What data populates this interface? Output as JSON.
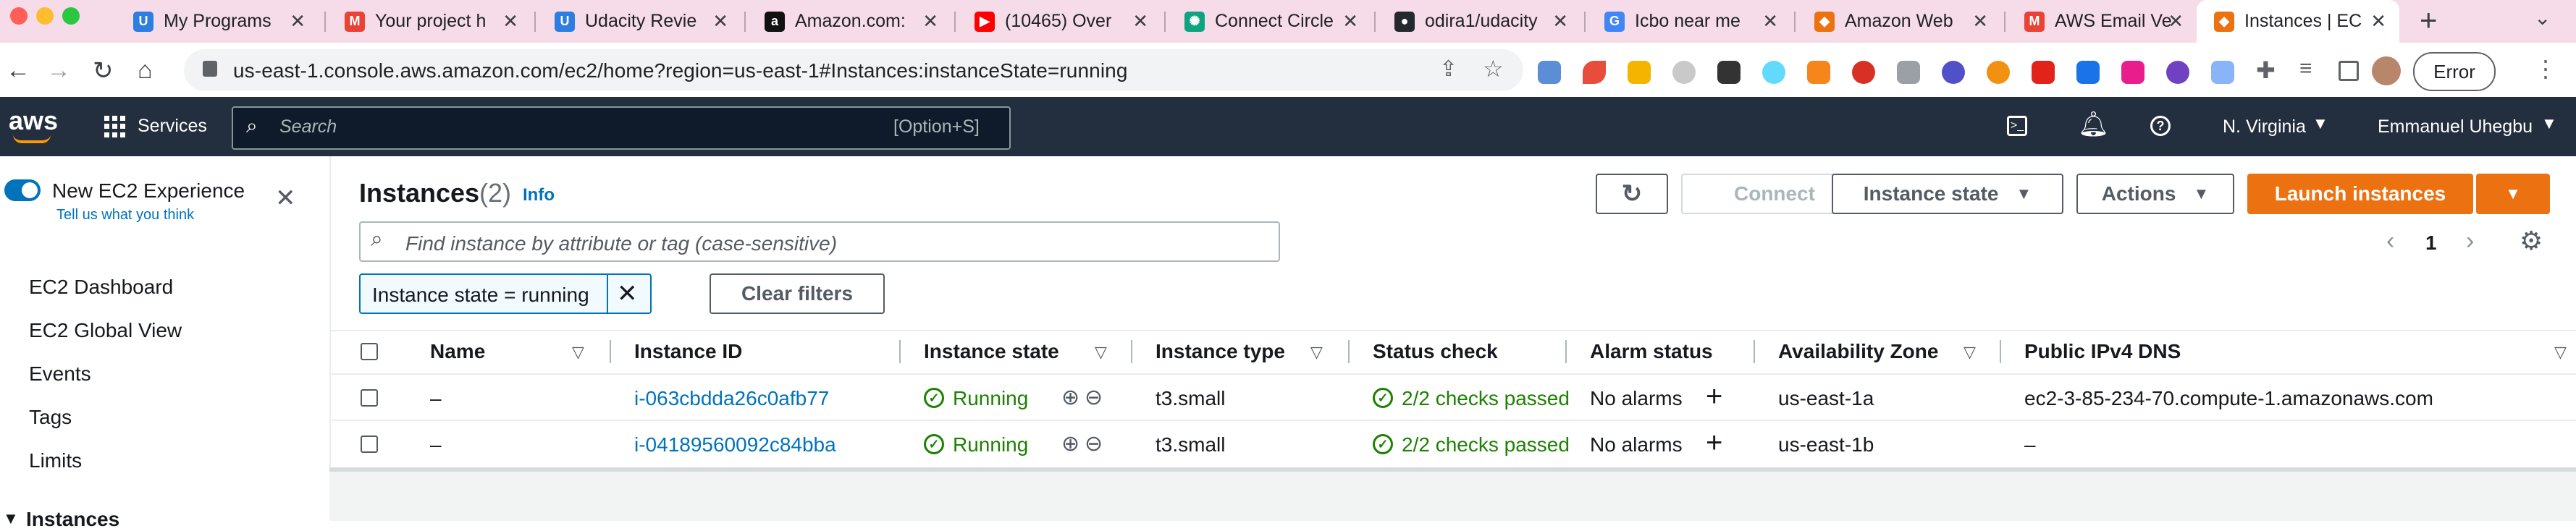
{
  "browser": {
    "tabs": [
      {
        "title": "My Programs",
        "icon": "udacity-icon",
        "color": "#2e7de1",
        "glyph": "U"
      },
      {
        "title": "Your project h",
        "icon": "gmail-icon",
        "color": "#ea4335",
        "glyph": "M"
      },
      {
        "title": "Udacity Revie",
        "icon": "udacity-icon",
        "color": "#2e7de1",
        "glyph": "U"
      },
      {
        "title": "Amazon.com:",
        "icon": "amazon-icon",
        "color": "#111111",
        "glyph": "a"
      },
      {
        "title": "(10465) Over",
        "icon": "youtube-icon",
        "color": "#ff0000",
        "glyph": "▶"
      },
      {
        "title": "Connect Circle",
        "icon": "chatgpt-icon",
        "color": "#10a37f",
        "glyph": "✺"
      },
      {
        "title": "odira1/udacity",
        "icon": "github-icon",
        "color": "#24292f",
        "glyph": "●"
      },
      {
        "title": "Icbo near me",
        "icon": "google-icon",
        "color": "#4285f4",
        "glyph": "G"
      },
      {
        "title": "Amazon Web",
        "icon": "aws-cube-icon",
        "color": "#ec7211",
        "glyph": "◆"
      },
      {
        "title": "AWS Email Ve",
        "icon": "gmail-icon",
        "color": "#ea4335",
        "glyph": "M"
      },
      {
        "title": "Instances | EC",
        "icon": "aws-cube-icon",
        "color": "#ec7211",
        "glyph": "◆"
      }
    ],
    "new_tab": "+",
    "url": "us-east-1.console.aws.amazon.com/ec2/home?region=us-east-1#Instances:instanceState=running",
    "error_label": "Error"
  },
  "aws_nav": {
    "logo": "aws",
    "services_label": "Services",
    "search_placeholder": "Search",
    "search_shortcut": "[Option+S]",
    "region": "N. Virginia",
    "user": "Emmanuel Uhegbu"
  },
  "side": {
    "toggle_label": "New EC2 Experience",
    "tell_us": "Tell us what you think",
    "links": [
      "EC2 Dashboard",
      "EC2 Global View",
      "Events",
      "Tags",
      "Limits"
    ],
    "section": "Instances"
  },
  "main": {
    "title": "Instances",
    "count": "(2)",
    "info": "Info",
    "connect": "Connect",
    "instance_state": "Instance state",
    "actions": "Actions",
    "launch": "Launch instances",
    "search_placeholder": "Find instance by attribute or tag (case-sensitive)",
    "filter_token": "Instance state = running",
    "clear_filters": "Clear filters",
    "page": "1"
  },
  "table": {
    "columns": [
      "Name",
      "Instance ID",
      "Instance state",
      "Instance type",
      "Status check",
      "Alarm status",
      "Availability Zone",
      "Public IPv4 DNS"
    ],
    "rows": [
      {
        "name": "–",
        "id": "i-063cbdda26c0afb77",
        "state": "Running",
        "type": "t3.small",
        "status": "2/2 checks passed",
        "alarm": "No alarms",
        "zone": "us-east-1a",
        "dns": "ec2-3-85-234-70.compute-1.amazonaws.com"
      },
      {
        "name": "–",
        "id": "i-04189560092c84bba",
        "state": "Running",
        "type": "t3.small",
        "status": "2/2 checks passed",
        "alarm": "No alarms",
        "zone": "us-east-1b",
        "dns": "–"
      }
    ]
  },
  "colors": {
    "aws_orange": "#ec7211",
    "aws_navy": "#232f3e",
    "link_blue": "#0073bb",
    "running_green": "#1d8102"
  }
}
